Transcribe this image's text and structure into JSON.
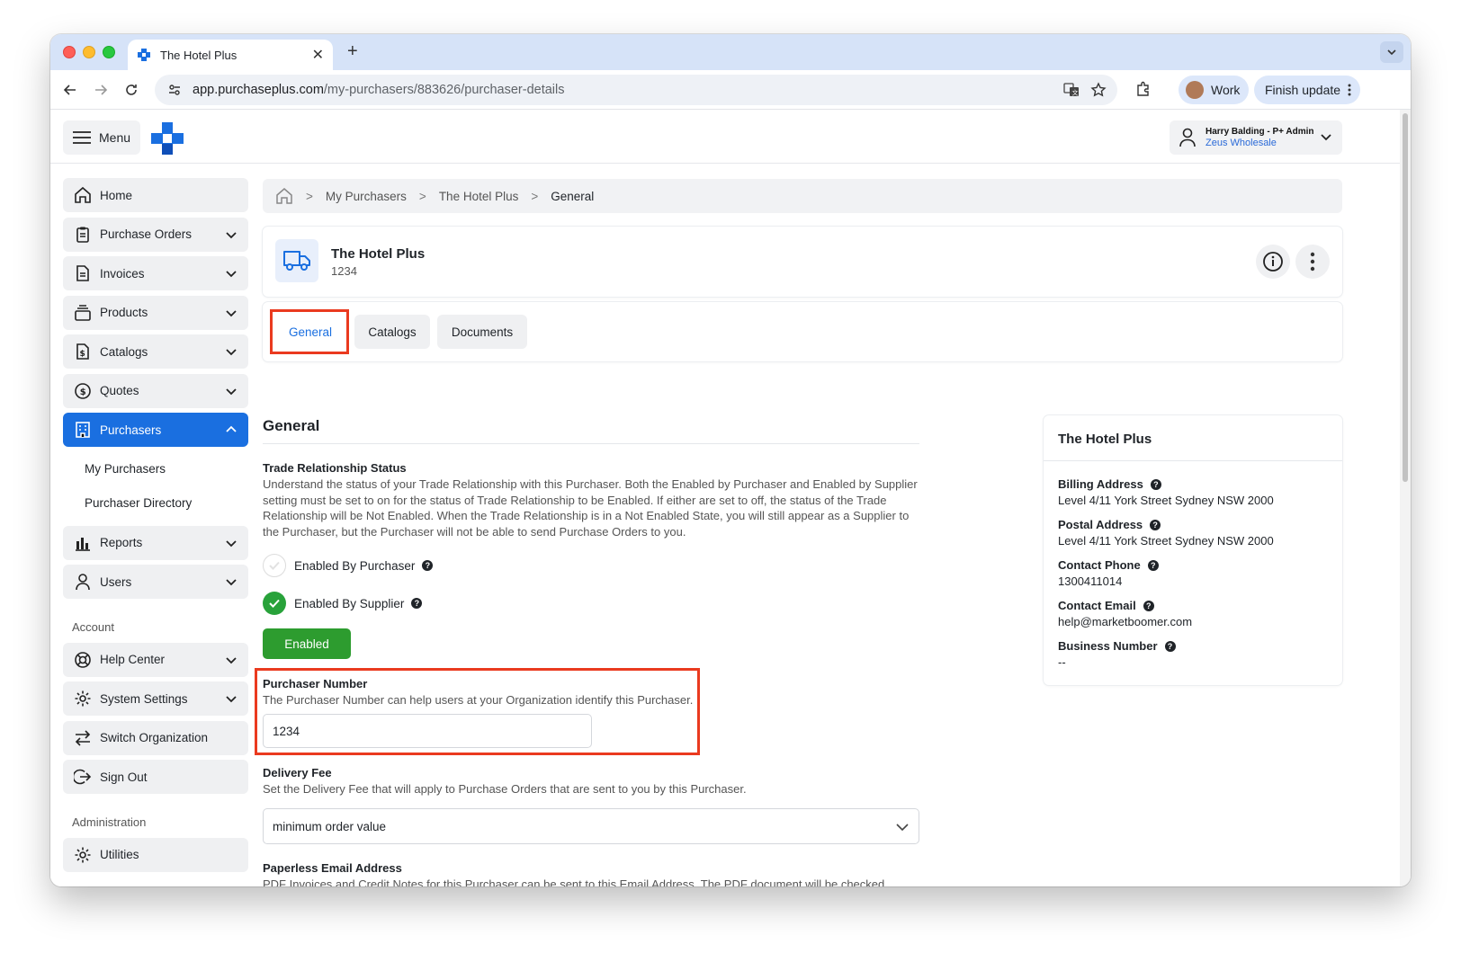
{
  "browser": {
    "tab_title": "The Hotel Plus",
    "url_host": "app.purchaseplus.com",
    "url_path": "/my-purchasers/883626/purchaser-details",
    "profile_label": "Work",
    "finish_update_label": "Finish update"
  },
  "header": {
    "menu_label": "Menu",
    "user_name": "Harry Balding - P+ Admin",
    "user_org": "Zeus Wholesale"
  },
  "sidebar": {
    "items": [
      {
        "label": "Home"
      },
      {
        "label": "Purchase Orders"
      },
      {
        "label": "Invoices"
      },
      {
        "label": "Products"
      },
      {
        "label": "Catalogs"
      },
      {
        "label": "Quotes"
      },
      {
        "label": "Purchasers"
      }
    ],
    "sub_items": [
      {
        "label": "My Purchasers"
      },
      {
        "label": "Purchaser Directory"
      }
    ],
    "items2": [
      {
        "label": "Reports"
      },
      {
        "label": "Users"
      }
    ],
    "account_heading": "Account",
    "account_items": [
      {
        "label": "Help Center"
      },
      {
        "label": "System Settings"
      },
      {
        "label": "Switch Organization"
      },
      {
        "label": "Sign Out"
      }
    ],
    "admin_heading": "Administration",
    "admin_items": [
      {
        "label": "Utilities"
      }
    ]
  },
  "breadcrumb": {
    "items": [
      "My Purchasers",
      "The Hotel Plus"
    ],
    "current": "General"
  },
  "purchaser": {
    "name": "The Hotel Plus",
    "number": "1234"
  },
  "tabs": [
    {
      "label": "General"
    },
    {
      "label": "Catalogs"
    },
    {
      "label": "Documents"
    }
  ],
  "general": {
    "heading": "General",
    "trade_label": "Trade Relationship Status",
    "trade_desc": "Understand the status of your Trade Relationship with this Purchaser. Both the Enabled by Purchaser and Enabled by Supplier setting must be set to on for the status of Trade Relationship to be Enabled. If either are set to off, the status of the Trade Relationship will be Not Enabled. When the Trade Relationship is in a Not Enabled State, you will still appear as a Supplier to the Purchaser, but the Purchaser will not be able to send Purchase Orders to you.",
    "enabled_by_purchaser": "Enabled By Purchaser",
    "enabled_by_supplier": "Enabled By Supplier",
    "status_button": "Enabled",
    "purchaser_number_label": "Purchaser Number",
    "purchaser_number_desc": "The Purchaser Number can help users at your Organization identify this Purchaser.",
    "purchaser_number_value": "1234",
    "delivery_fee_label": "Delivery Fee",
    "delivery_fee_desc": "Set the Delivery Fee that will apply to Purchase Orders that are sent to you by this Purchaser.",
    "delivery_fee_value": "minimum order value",
    "paperless_label": "Paperless Email Address",
    "paperless_desc": "PDF Invoices and Credit Notes for this Purchaser can be sent to this Email Address. The PDF document will be checked,"
  },
  "info": {
    "title": "The Hotel Plus",
    "billing_label": "Billing Address",
    "billing_value": "Level 4/11 York Street Sydney NSW 2000",
    "postal_label": "Postal Address",
    "postal_value": "Level 4/11 York Street Sydney NSW 2000",
    "phone_label": "Contact Phone",
    "phone_value": "1300411014",
    "email_label": "Contact Email",
    "email_value": "help@marketboomer.com",
    "business_label": "Business Number",
    "business_value": "--"
  },
  "colors": {
    "accent": "#1a6fe0",
    "success": "#2d9c2f",
    "highlight": "#ea3a1f"
  }
}
